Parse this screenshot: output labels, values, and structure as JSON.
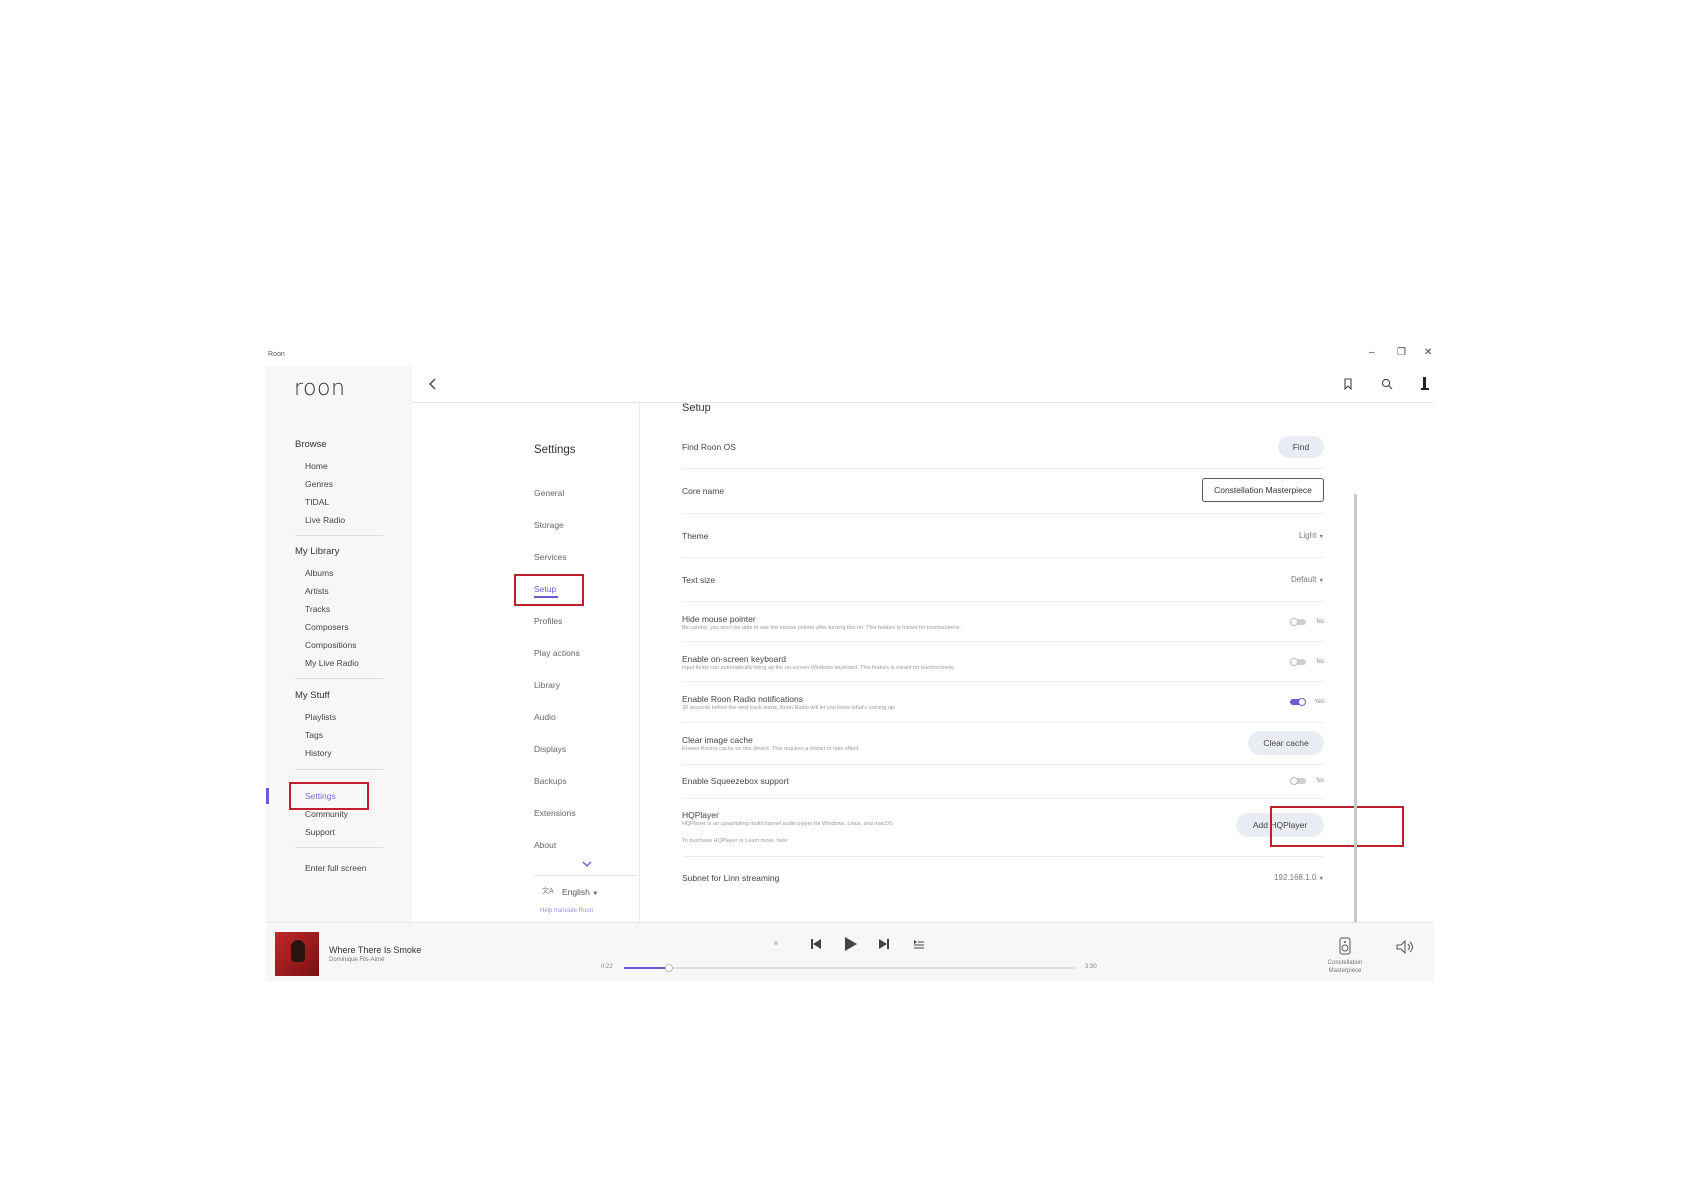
{
  "window": {
    "title": "Roon",
    "title_icon": "roon-small-icon",
    "controls": [
      "–",
      "❐",
      "✕"
    ]
  },
  "sidebar": {
    "logo": "roon",
    "browse": {
      "heading": "Browse",
      "items": [
        "Home",
        "Genres",
        "TIDAL",
        "Live Radio"
      ]
    },
    "library": {
      "heading": "My Library",
      "items": [
        "Albums",
        "Artists",
        "Tracks",
        "Composers",
        "Compositions",
        "My Live Radio"
      ]
    },
    "stuff": {
      "heading": "My Stuff",
      "items": [
        "Playlists",
        "Tags",
        "History"
      ]
    },
    "bottom": {
      "settings": "Settings",
      "community": "Community",
      "support": "Support"
    },
    "fullscreen": "Enter full screen"
  },
  "header": {
    "back_icon": "chevron-left-icon",
    "icons": [
      "bookmark-icon",
      "search-icon",
      "profile-icon"
    ]
  },
  "settings_nav": {
    "title": "Settings",
    "items": [
      "General",
      "Storage",
      "Services",
      "Setup",
      "Profiles",
      "Play actions",
      "Library",
      "Audio",
      "Displays",
      "Backups",
      "Extensions",
      "About"
    ],
    "active": "Setup",
    "language": "English",
    "translate": "Help translate Roon"
  },
  "setup": {
    "title": "Setup",
    "find_os": {
      "label": "Find Roon OS",
      "button": "Find"
    },
    "core_name": {
      "label": "Core name",
      "value": "Constellation Masterpiece"
    },
    "theme": {
      "label": "Theme",
      "value": "Light"
    },
    "text_size": {
      "label": "Text size",
      "value": "Default"
    },
    "hide_pointer": {
      "label": "Hide mouse pointer",
      "desc": "Be careful, you won't be able to see the mouse pointer after turning this on. This feature is meant for touchscreens.",
      "state": "No"
    },
    "keyboard": {
      "label": "Enable on-screen keyboard",
      "desc": "Input fields can automatically bring up the on-screen Windows keyboard. This feature is meant for touchscreens.",
      "state": "No"
    },
    "radio_notif": {
      "label": "Enable Roon Radio notifications",
      "desc": "30 seconds before the next track starts, Roon Radio will let you know what's coming up.",
      "state": "Yes"
    },
    "image_cache": {
      "label": "Clear image cache",
      "desc": "Erases Roon's cache on this device. This requires a restart to take effect.",
      "button": "Clear cache"
    },
    "squeezebox": {
      "label": "Enable Squeezebox support",
      "state": "No"
    },
    "hqplayer": {
      "label": "HQPlayer",
      "desc": "HQPlayer is an upsampling multichannel audio player for Windows, Linux, and macOS",
      "desc2": "To purchase HQPlayer or Learn more, here",
      "button": "Add HQPlayer"
    },
    "subnet": {
      "label": "Subnet for Linn streaming",
      "value": "192.168.1.0"
    }
  },
  "player": {
    "track": "Where There Is Smoke",
    "artist": "Dominique Fils-Aimé",
    "elapsed": "0:22",
    "duration": "3:30",
    "progress": 0.1,
    "zone": "Constellation Masterpiece",
    "accent": "#6c5ad0"
  }
}
